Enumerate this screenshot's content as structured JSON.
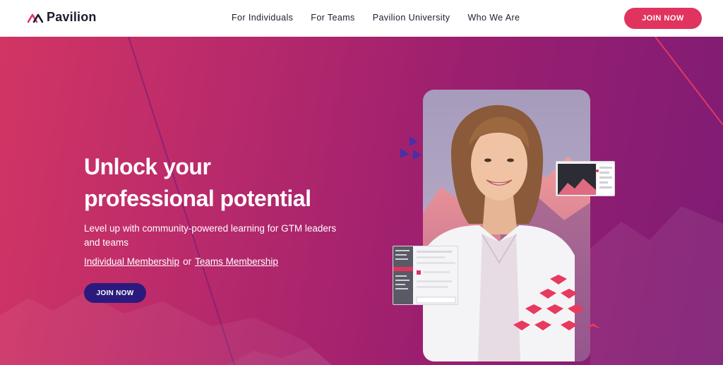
{
  "brand": {
    "name": "Pavilion",
    "accent": "#e0345f",
    "dark": "#2b1a7e"
  },
  "nav": {
    "links": [
      "For Individuals",
      "For Teams",
      "Pavilion University",
      "Who We Are"
    ],
    "cta_label": "JOIN NOW"
  },
  "hero": {
    "headline_line1": "Unlock your",
    "headline_line2": "professional potential",
    "subtext": "Level up with community-powered learning for GTM leaders and teams",
    "link_individual": "Individual Membership",
    "or_text": "or",
    "link_teams": "Teams Membership",
    "cta_label": "JOIN NOW"
  }
}
